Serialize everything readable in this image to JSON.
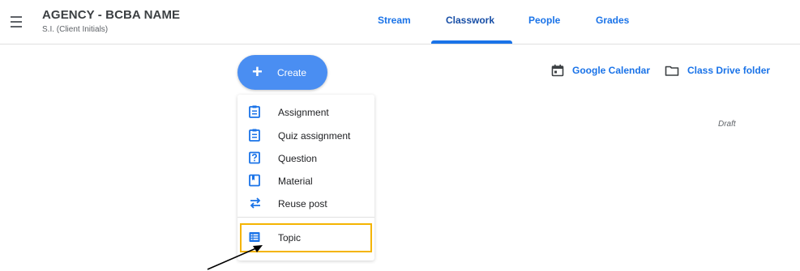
{
  "header": {
    "class_name": "AGENCY - BCBA NAME",
    "class_section": "S.I. (Client Initials)",
    "tabs": [
      {
        "label": "Stream"
      },
      {
        "label": "Classwork",
        "active": true
      },
      {
        "label": "People"
      },
      {
        "label": "Grades"
      }
    ]
  },
  "toolbar": {
    "create_label": "Create",
    "calendar_label": "Google Calendar",
    "drive_label": "Class Drive folder"
  },
  "status": {
    "draft_label": "Draft"
  },
  "create_menu": {
    "items": [
      {
        "label": "Assignment",
        "icon": "assignment-icon"
      },
      {
        "label": "Quiz assignment",
        "icon": "quiz-assignment-icon"
      },
      {
        "label": "Question",
        "icon": "question-icon"
      },
      {
        "label": "Material",
        "icon": "material-icon"
      },
      {
        "label": "Reuse post",
        "icon": "reuse-post-icon"
      },
      {
        "label": "Topic",
        "icon": "topic-icon"
      }
    ]
  },
  "colors": {
    "accent": "#1a73e8",
    "create_button": "#4a8ef2",
    "highlight_border": "#f4b400"
  }
}
